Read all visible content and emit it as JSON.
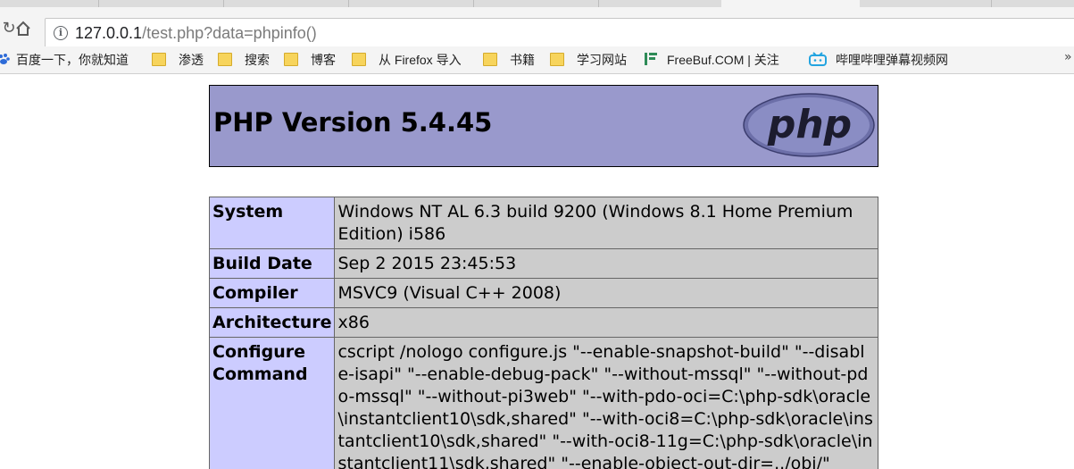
{
  "browser": {
    "url_host": "127.0.0.1",
    "url_rest": "/test.php?data=phpinfo()",
    "bookmarks": [
      {
        "label": "百度一下，你就知道",
        "icon": "baidu-paw-icon"
      },
      {
        "label": "渗透",
        "icon": "folder-icon"
      },
      {
        "label": "搜索",
        "icon": "folder-icon"
      },
      {
        "label": "博客",
        "icon": "folder-icon"
      },
      {
        "label": "从 Firefox 导入",
        "icon": "folder-icon"
      },
      {
        "label": "书籍",
        "icon": "folder-icon"
      },
      {
        "label": "学习网站",
        "icon": "folder-icon"
      },
      {
        "label": "FreeBuf.COM | 关注",
        "icon": "freebuf-icon"
      },
      {
        "label": "哔哩哔哩弹幕视频网",
        "icon": "bilibili-icon"
      }
    ],
    "overflow_label": "»"
  },
  "page": {
    "title": "PHP Version 5.4.45",
    "logo_text": "php",
    "rows": [
      {
        "key": "System",
        "value": "Windows NT AL 6.3 build 9200 (Windows 8.1 Home Premium Edition) i586"
      },
      {
        "key": "Build Date",
        "value": "Sep 2 2015 23:45:53"
      },
      {
        "key": "Compiler",
        "value": "MSVC9 (Visual C++ 2008)"
      },
      {
        "key": "Architecture",
        "value": "x86"
      },
      {
        "key": "Configure Command",
        "value": "cscript /nologo configure.js \"--enable-snapshot-build\" \"--disable-isapi\" \"--enable-debug-pack\" \"--without-mssql\" \"--without-pdo-mssql\" \"--without-pi3web\" \"--with-pdo-oci=C:\\php-sdk\\oracle\\instantclient10\\sdk,shared\" \"--with-oci8=C:\\php-sdk\\oracle\\instantclient10\\sdk,shared\" \"--with-oci8-11g=C:\\php-sdk\\oracle\\instantclient11\\sdk,shared\" \"--enable-object-out-dir=../obj/\""
      }
    ]
  },
  "colors": {
    "header_bg": "#9999cc",
    "key_bg": "#ccccff",
    "value_bg": "#cccccc"
  }
}
